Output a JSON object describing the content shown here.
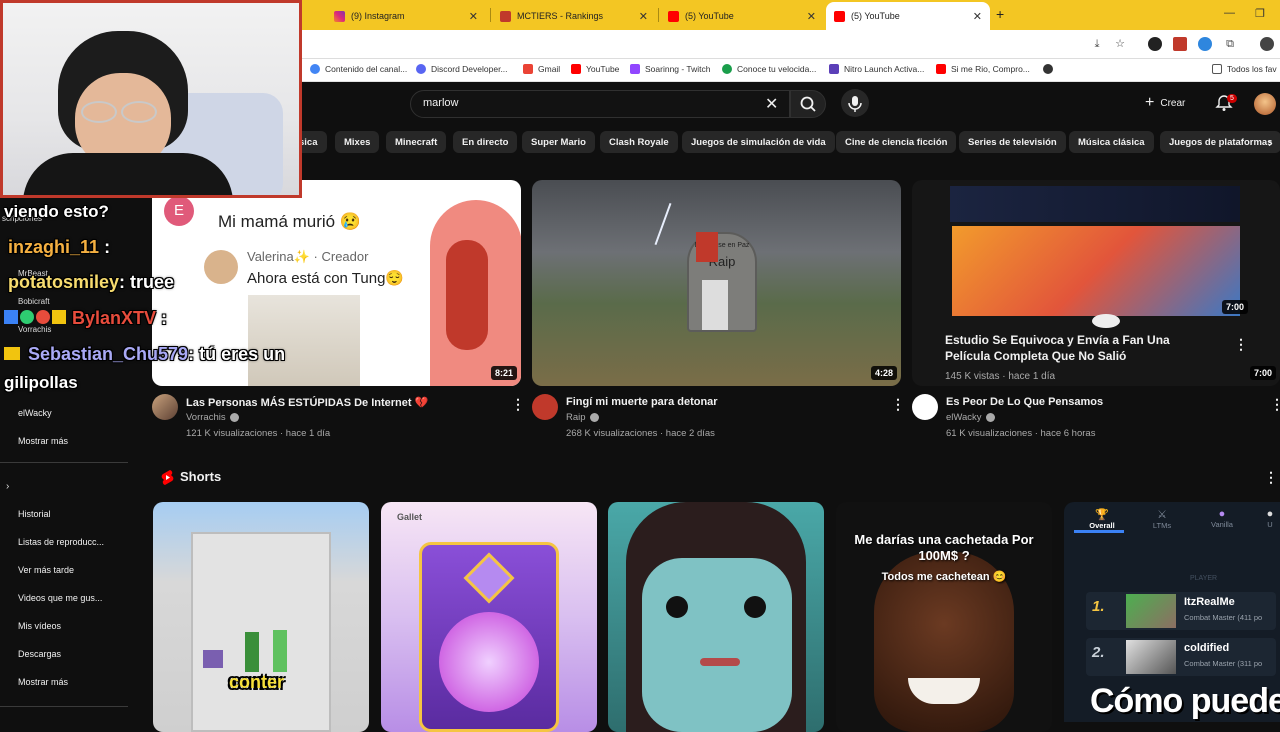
{
  "browser": {
    "tabs": [
      {
        "label": "(9) Instagram",
        "color": "#e1306c"
      },
      {
        "label": "MCTIERS - Rankings",
        "color": "#c0392b"
      },
      {
        "label": "(5) YouTube",
        "color": "#ff0000"
      },
      {
        "label": "(5) YouTube",
        "color": "#ff0000"
      }
    ],
    "new_tab": "+",
    "bookmarks": [
      {
        "label": "Contenido del canal...",
        "color": "#4285f4"
      },
      {
        "label": "Discord Developer...",
        "color": "#5865f2"
      },
      {
        "label": "Gmail",
        "color": "#ea4335"
      },
      {
        "label": "YouTube",
        "color": "#ff0000"
      },
      {
        "label": "Soarinng - Twitch",
        "color": "#9146ff"
      },
      {
        "label": "Conoce tu velocida...",
        "color": "#1a9e4b"
      },
      {
        "label": "Nitro Launch Activa...",
        "color": "#5b3fb8"
      },
      {
        "label": "Si me Rio, Compro...",
        "color": "#ff0000"
      },
      {
        "label": "Todos los fav",
        "color": "#777"
      }
    ]
  },
  "youtube": {
    "search": {
      "value": "marlow"
    },
    "create_label": "Crear",
    "notif_count": "5",
    "chips": [
      "sica",
      "Mixes",
      "Minecraft",
      "En directo",
      "Super Mario",
      "Clash Royale",
      "Juegos de simulación de vida",
      "Cine de ciencia ficción",
      "Series de televisión",
      "Música clásica",
      "Juegos de plataformas"
    ],
    "sidebar": {
      "top_items": [
        "elWacky",
        "Mostrar más"
      ],
      "items": [
        "Historial",
        "Listas de reproducc...",
        "Ver más tarde",
        "Videos que me gus...",
        "Mis vídeos",
        "Descargas",
        "Mostrar más"
      ]
    },
    "videos": [
      {
        "title": "Las Personas MÁS ESTÚPIDAS De Internet 💔",
        "channel": "Vorrachis",
        "meta": "121 K visualizaciones · hace 1 día",
        "duration": "8:21",
        "thumb_text": {
          "top": "Mi mamá murió 😢",
          "creator": "Valerina✨ · Creador",
          "bottom": "Ahora está con Tung😌"
        }
      },
      {
        "title": "Fingí mi muerte para detonar",
        "channel": "Raip",
        "meta": "268 K visualizaciones · hace 2 días",
        "duration": "4:28",
        "thumb_text": {
          "grave1": "Descanse en Paz",
          "grave2": "Raip"
        }
      },
      {
        "title": "Es Peor De Lo Que Pensamos",
        "channel": "elWacky",
        "meta": "61 K visualizaciones · hace 6 horas",
        "duration": "7:00",
        "thumb_text": {
          "overlay_title": "Estudio Se Equivoca y Envía a Fan Una Película Completa Que No Salió",
          "overlay_meta": "145 K vistas · hace 1 día",
          "overlay_dur": "7:00"
        }
      }
    ],
    "shorts": {
      "title": "Shorts",
      "items": [
        {
          "caption": "conter"
        },
        {
          "caption": "Gallet"
        },
        {
          "caption": ""
        },
        {
          "caption_top": "Me darías una cachetada Por 100M$ ?",
          "caption_sub": "Todos me cachetean 😊"
        }
      ]
    },
    "mctiers": {
      "tabs": [
        "Overall",
        "LTMs",
        "Vanilla",
        "U"
      ],
      "header": "PLAYER",
      "rows": [
        {
          "rank": "1.",
          "name": "ItzRealMe",
          "sub": "Combat Master (411 po"
        },
        {
          "rank": "2.",
          "name": "coldified",
          "sub": "Combat Master (311 po"
        }
      ],
      "overlay_text": "Cómo puede"
    }
  },
  "chat": [
    {
      "user": "viendo esto?",
      "color": "#ffffff"
    },
    {
      "user": "inzaghi_11",
      "msg": ":",
      "color": "#f5b041"
    },
    {
      "user": "potatosmiley",
      "msg": ": truee",
      "color": "#f7dc6f"
    },
    {
      "user": "BylanXTV",
      "msg": ":",
      "color": "#e74c3c"
    },
    {
      "user": "Sebastian_Chu579",
      "msg": ": tú eres un",
      "color": "#a9a9f5"
    },
    {
      "user": "gilipollas",
      "color": "#ffffff"
    }
  ],
  "chat_small": [
    "scripciones",
    "MrBeast",
    "Bobicraft",
    "Vorrachis"
  ]
}
